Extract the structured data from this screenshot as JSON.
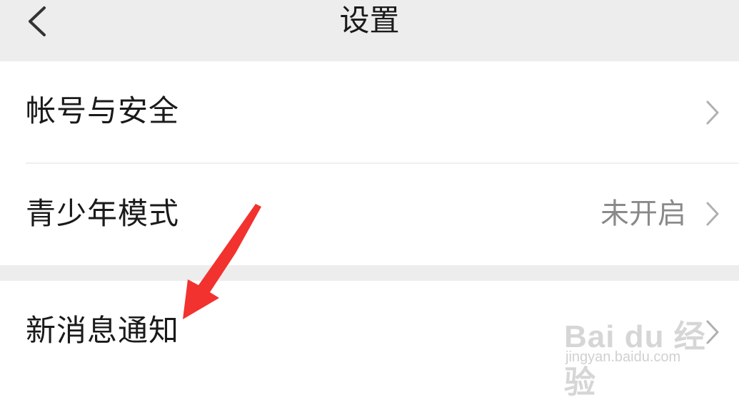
{
  "header": {
    "title": "设置",
    "back_icon": "chevron-left-icon"
  },
  "settings": {
    "items": [
      {
        "label": "帐号与安全",
        "value": ""
      },
      {
        "label": "青少年模式",
        "value": "未开启"
      },
      {
        "label": "新消息通知",
        "value": ""
      }
    ]
  },
  "watermark": {
    "logo": "Bai du 经验",
    "url": "jingyan.baidu.com"
  },
  "colors": {
    "header_bg": "#ededed",
    "section_bg": "#ffffff",
    "gap_bg": "#ededed",
    "text_primary": "#1a1a1a",
    "text_secondary": "#8a8a8a",
    "chevron": "#b0b0b0",
    "annotation_arrow": "#f2322f"
  }
}
